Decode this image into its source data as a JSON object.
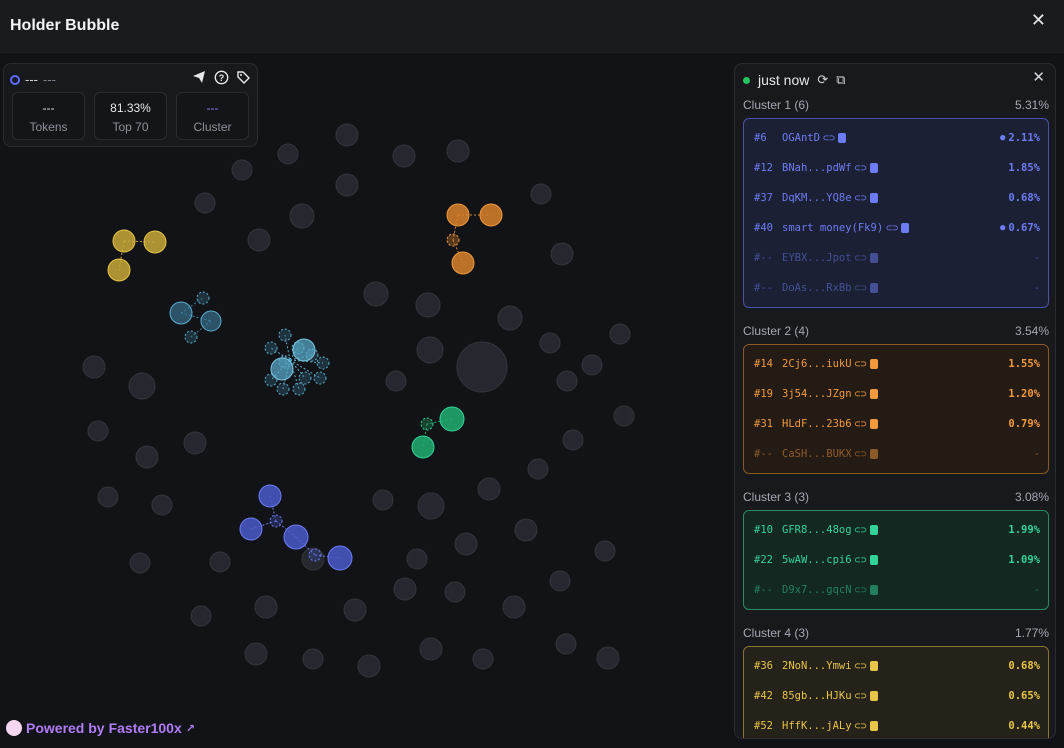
{
  "window": {
    "title": "Holder Bubble"
  },
  "info": {
    "address": "---",
    "address_sub": "---",
    "stats": [
      {
        "value": "---",
        "label": "Tokens"
      },
      {
        "value": "81.33%",
        "label": "Top 70"
      },
      {
        "value": "---",
        "label": "Cluster"
      }
    ]
  },
  "powered": {
    "prefix": "Powered by",
    "brand": "Faster100x"
  },
  "panel": {
    "status": "just now",
    "clusters": [
      {
        "label": "Cluster 1 (6)",
        "pct": "5.31%",
        "color": "#6d7cf5",
        "bg": "#1c2034",
        "border": "#4653a8",
        "rows": [
          {
            "rank": "#6",
            "name": "OGAntD",
            "pct": "2.11%",
            "bulb": true
          },
          {
            "rank": "#12",
            "name": "BNah...pdWf",
            "pct": "1.85%"
          },
          {
            "rank": "#37",
            "name": "DqKM...YQ8e",
            "pct": "0.68%"
          },
          {
            "rank": "#40",
            "name": "smart money(Fk9)",
            "pct": "0.67%",
            "bulb": true
          },
          {
            "rank": "#--",
            "name": "EYBX...Jpot",
            "pct": "-",
            "dim": true
          },
          {
            "rank": "#--",
            "name": "DoAs...RxBb",
            "pct": "-",
            "dim": true
          }
        ]
      },
      {
        "label": "Cluster 2 (4)",
        "pct": "3.54%",
        "color": "#f2993e",
        "bg": "#241c14",
        "border": "#8a5a25",
        "rows": [
          {
            "rank": "#14",
            "name": "2Cj6...iukU",
            "pct": "1.55%"
          },
          {
            "rank": "#19",
            "name": "3j54...JZgn",
            "pct": "1.20%"
          },
          {
            "rank": "#31",
            "name": "HLdF...23b6",
            "pct": "0.79%"
          },
          {
            "rank": "#--",
            "name": "CaSH...BUKX",
            "pct": "-",
            "dim": true
          }
        ]
      },
      {
        "label": "Cluster 3 (3)",
        "pct": "3.08%",
        "color": "#34d399",
        "bg": "#132821",
        "border": "#2c8a65",
        "rows": [
          {
            "rank": "#10",
            "name": "GFR8...48og",
            "pct": "1.99%"
          },
          {
            "rank": "#22",
            "name": "5wAW...cpi6",
            "pct": "1.09%"
          },
          {
            "rank": "#--",
            "name": "D9x7...gqcN",
            "pct": "-",
            "dim": true
          }
        ]
      },
      {
        "label": "Cluster 4 (3)",
        "pct": "1.77%",
        "color": "#e8c547",
        "bg": "#25221a",
        "border": "#8a7630",
        "rows": [
          {
            "rank": "#36",
            "name": "2NoN...Ymwi",
            "pct": "0.68%"
          },
          {
            "rank": "#42",
            "name": "85gb...HJKu",
            "pct": "0.65%"
          },
          {
            "rank": "#52",
            "name": "HffK...jALy",
            "pct": "0.44%"
          }
        ]
      }
    ]
  },
  "bubble_colors": {
    "grey": "#25282e",
    "yellow": "#c9a93a",
    "orange": "#d9822b",
    "blue": "#4a5bc9",
    "green": "#20b070",
    "teal": "#3f7fa0",
    "teal_light": "#5aaecf"
  }
}
